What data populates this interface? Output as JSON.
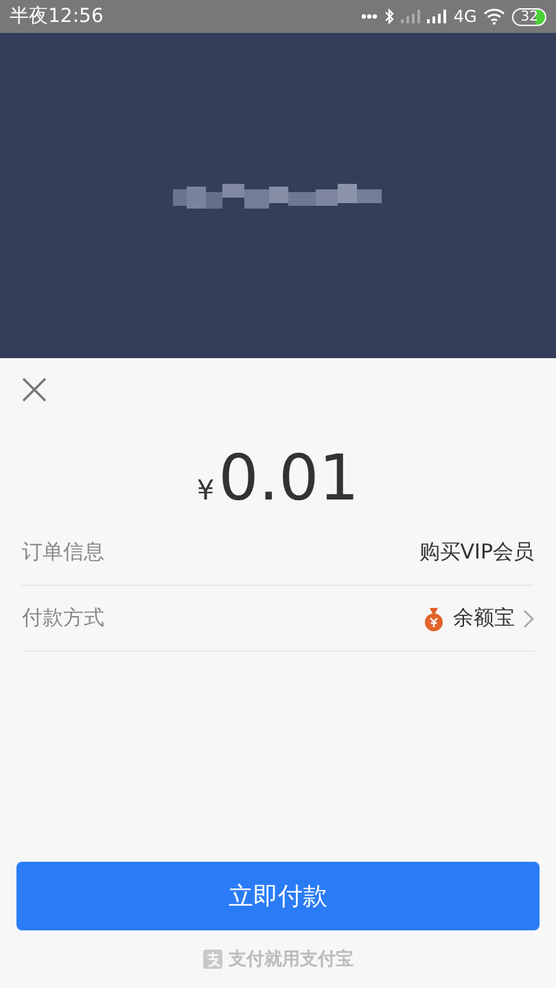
{
  "status_bar": {
    "time": "半夜12:56",
    "network": "4G",
    "battery": "32"
  },
  "payment": {
    "amount_currency": "¥",
    "amount": "0.01",
    "rows": [
      {
        "kind": "info",
        "label": "订单信息",
        "value": "购买VIP会员"
      },
      {
        "kind": "method",
        "label": "付款方式",
        "value": "余额宝"
      }
    ],
    "pay_button": "立即付款",
    "footer": "支付就用支付宝"
  }
}
